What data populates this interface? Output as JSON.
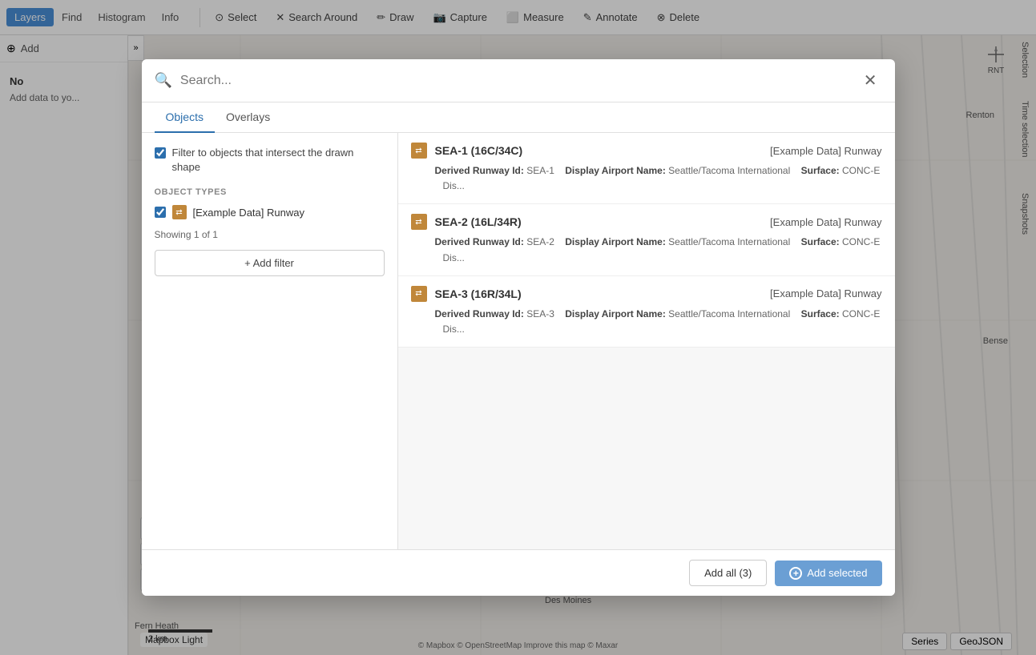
{
  "toolbar": {
    "tabs": [
      {
        "label": "Layers",
        "active": true
      },
      {
        "label": "Find",
        "active": false
      },
      {
        "label": "Histogram",
        "active": false
      },
      {
        "label": "Info",
        "active": false
      }
    ],
    "buttons": [
      {
        "label": "Select",
        "icon": "⊙"
      },
      {
        "label": "Search Around",
        "icon": "✕"
      },
      {
        "label": "Draw",
        "icon": "✏"
      },
      {
        "label": "Capture",
        "icon": "📷"
      },
      {
        "label": "Measure",
        "icon": "⬜"
      },
      {
        "label": "Annotate",
        "icon": "✎"
      },
      {
        "label": "Delete",
        "icon": "⊗"
      }
    ],
    "add_btn_label": "Add"
  },
  "right_panel": {
    "labels": [
      "Selection",
      "Time selection",
      "Snapshots"
    ]
  },
  "map": {
    "style_label": "Mapbox Light",
    "compass_label": "RNT",
    "labels": [
      "Renton",
      "Des Moines",
      "Fern Heath",
      "Bense"
    ],
    "attribution": "© Mapbox © OpenStreetMap Improve this map © Maxar",
    "scale_label": "2 km"
  },
  "bottom_right": {
    "series_label": "Series",
    "geojson_label": "GeoJSON"
  },
  "modal": {
    "search_placeholder": "Search...",
    "tabs": [
      {
        "label": "Objects",
        "active": true
      },
      {
        "label": "Overlays",
        "active": false
      }
    ],
    "filter": {
      "intersect_label": "Filter to objects that intersect the drawn shape",
      "intersect_checked": true,
      "section_title": "OBJECT TYPES",
      "object_types": [
        {
          "label": "[Example Data] Runway",
          "checked": true,
          "icon": "⇄"
        }
      ],
      "showing_label": "Showing 1 of 1",
      "add_filter_label": "+ Add filter"
    },
    "results": [
      {
        "id": "result-1",
        "title": "SEA-1 (16C/34C)",
        "type": "[Example Data] Runway",
        "meta_items": [
          {
            "key": "Derived Runway Id:",
            "value": "SEA-1"
          },
          {
            "key": "Display Airport Name:",
            "value": "Seattle/Tacoma International"
          },
          {
            "key": "Surface:",
            "value": "CONC-E"
          },
          {
            "key": "Dis...",
            "value": ""
          }
        ]
      },
      {
        "id": "result-2",
        "title": "SEA-2 (16L/34R)",
        "type": "[Example Data] Runway",
        "meta_items": [
          {
            "key": "Derived Runway Id:",
            "value": "SEA-2"
          },
          {
            "key": "Display Airport Name:",
            "value": "Seattle/Tacoma International"
          },
          {
            "key": "Surface:",
            "value": "CONC-E"
          },
          {
            "key": "Dis...",
            "value": ""
          }
        ]
      },
      {
        "id": "result-3",
        "title": "SEA-3 (16R/34L)",
        "type": "[Example Data] Runway",
        "meta_items": [
          {
            "key": "Derived Runway Id:",
            "value": "SEA-3"
          },
          {
            "key": "Display Airport Name:",
            "value": "Seattle/Tacoma International"
          },
          {
            "key": "Surface:",
            "value": "CONC-E"
          },
          {
            "key": "Dis...",
            "value": ""
          }
        ]
      }
    ],
    "footer": {
      "add_all_label": "Add all (3)",
      "add_selected_label": "Add selected"
    }
  }
}
